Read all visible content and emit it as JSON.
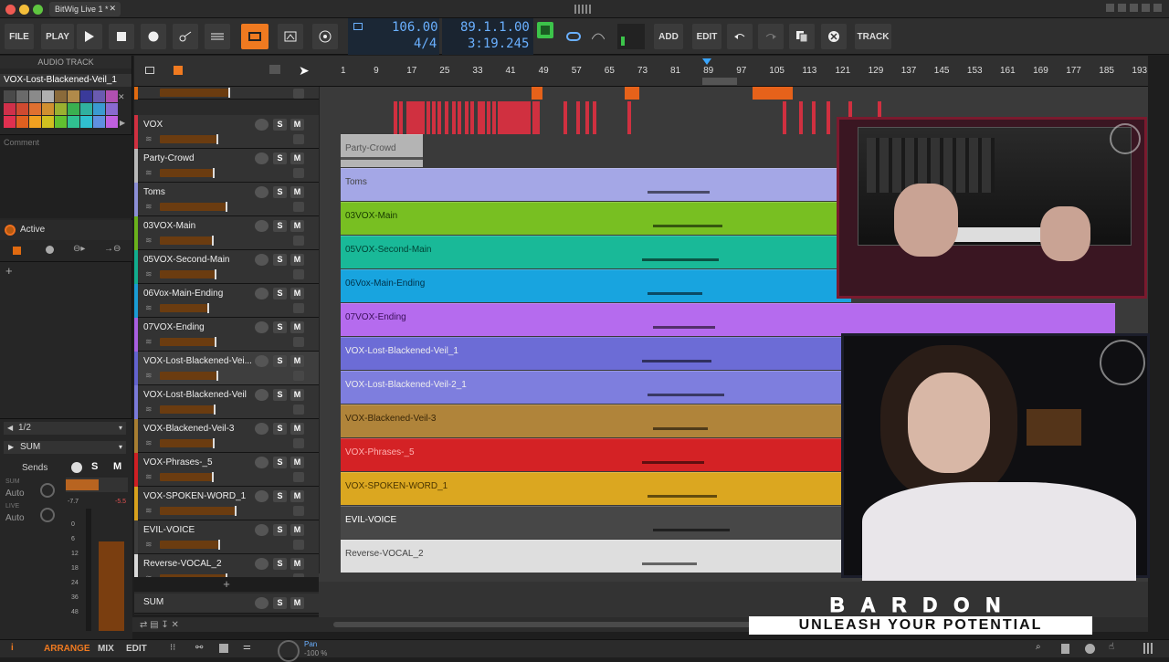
{
  "window": {
    "tab_title": "BitWig Live 1 *",
    "tab_close": "✕"
  },
  "toolbar": {
    "file": "FILE",
    "play_label": "PLAY",
    "add": "ADD",
    "edit": "EDIT",
    "track": "TRACK",
    "tempo": "106.00",
    "signature": "4/4",
    "position": "89.1.1.00",
    "time": "3:19.245"
  },
  "inspector": {
    "section": "AUDIO TRACK",
    "track_name": "VOX-Lost-Blackened-Veil_1",
    "comment_label": "Comment",
    "device_label": "Active",
    "add": "+",
    "palette": [
      "#4a4a4a",
      "#6a6a6a",
      "#8a8a8a",
      "#b0b0b0",
      "#8a6a3a",
      "#b08a4a",
      "#3a3a9a",
      "#6a5ab0",
      "#b050b0",
      "#d0304a",
      "#d04a30",
      "#e07030",
      "#d09030",
      "#9ab030",
      "#3ab050",
      "#30b0a0",
      "#3a9ad0",
      "#8a6ad0",
      "#e03050",
      "#e06020",
      "#f0a020",
      "#d0c020",
      "#60c030",
      "#30c090",
      "#30c0d0",
      "#6090e0",
      "#c060e0"
    ]
  },
  "sends": {
    "page": "1/2",
    "sum": "SUM",
    "sends_label": "Sends",
    "s": "S",
    "m": "M",
    "sum_small": "SUM",
    "auto1": "Auto",
    "live": "LIVE",
    "auto2": "Auto",
    "db_left": "-7.7",
    "db_right": "-5.5",
    "scale": [
      "0",
      "6",
      "12",
      "18",
      "24",
      "36",
      "48"
    ]
  },
  "tracks": [
    {
      "name": "",
      "color": "#e06a10",
      "fader": 0.75
    },
    {
      "name": "VOX",
      "color": "#d03040",
      "fader": 0.62
    },
    {
      "name": "Party-Crowd",
      "color": "#b9b9b9",
      "fader": 0.58
    },
    {
      "name": "Toms",
      "color": "#8c8fd6",
      "fader": 0.72
    },
    {
      "name": "03VOX-Main",
      "color": "#6ab21c",
      "fader": 0.57
    },
    {
      "name": "05VOX-Second-Main",
      "color": "#12ad8e",
      "fader": 0.6
    },
    {
      "name": "06Vox-Main-Ending",
      "color": "#1a9cd4",
      "fader": 0.52
    },
    {
      "name": "07VOX-Ending",
      "color": "#a85fe0",
      "fader": 0.6
    },
    {
      "name": "VOX-Lost-Blackened-Vei...",
      "color": "#6363cf",
      "fader": 0.62
    },
    {
      "name": "VOX-Lost-Blackened-Veil",
      "color": "#7a7ad9",
      "fader": 0.59
    },
    {
      "name": "VOX-Blackened-Veil-3",
      "color": "#a87e32",
      "fader": 0.58
    },
    {
      "name": "VOX-Phrases-_5",
      "color": "#cf1f23",
      "fader": 0.57
    },
    {
      "name": "VOX-SPOKEN-WORD_1",
      "color": "#d8a11d",
      "fader": 0.82
    },
    {
      "name": "EVIL-VOICE",
      "color": "#3d3d3d",
      "fader": 0.64
    },
    {
      "name": "Reverse-VOCAL_2",
      "color": "#d9d9d9",
      "fader": 0.72
    }
  ],
  "sum_track": {
    "name": "SUM"
  },
  "add_track": "+",
  "btn": {
    "s": "S",
    "m": "M"
  },
  "ruler": [
    "1",
    "9",
    "17",
    "25",
    "33",
    "41",
    "49",
    "57",
    "65",
    "73",
    "81",
    "89",
    "97",
    "105",
    "113",
    "121",
    "129",
    "137",
    "145",
    "153",
    "161",
    "169",
    "177",
    "185",
    "193"
  ],
  "clips": [
    {
      "label": "Party-Crowd",
      "color": "#b4b4b4",
      "text": "#555",
      "start": 1,
      "end": 21
    },
    {
      "label": "Toms",
      "color": "#a4a7e6",
      "text": "#444",
      "start": 1,
      "end": 125
    },
    {
      "label": "03VOX-Main",
      "color": "#78bf22",
      "text": "#173a00",
      "start": 1,
      "end": 125
    },
    {
      "label": "05VOX-Second-Main",
      "color": "#19b998",
      "text": "#004436",
      "start": 1,
      "end": 125
    },
    {
      "label": "06Vox-Main-Ending",
      "color": "#18a4df",
      "text": "#00324a",
      "start": 1,
      "end": 125
    },
    {
      "label": "07VOX-Ending",
      "color": "#b56bee",
      "text": "#3a1058",
      "start": 1,
      "end": 189
    },
    {
      "label": "VOX-Lost-Blackened-Veil_1",
      "color": "#6c6cd6",
      "text": "#eee",
      "start": 1,
      "end": 125
    },
    {
      "label": "VOX-Lost-Blackened-Veil-2_1",
      "color": "#7e7ede",
      "text": "#eee",
      "start": 1,
      "end": 125
    },
    {
      "label": "VOX-Blackened-Veil-3",
      "color": "#b0843a",
      "text": "#3a2708",
      "start": 1,
      "end": 125
    },
    {
      "label": "VOX-Phrases-_5",
      "color": "#d42225",
      "text": "#ffb0b0",
      "start": 1,
      "end": 125
    },
    {
      "label": "VOX-SPOKEN-WORD_1",
      "color": "#dba720",
      "text": "#4a3500",
      "start": 1,
      "end": 125
    },
    {
      "label": "EVIL-VOICE",
      "color": "#474747",
      "text": "#fff",
      "start": 1,
      "end": 125
    },
    {
      "label": "Reverse-VOCAL_2",
      "color": "#dedede",
      "text": "#444",
      "start": 1,
      "end": 125
    }
  ],
  "bottom": {
    "arrange": "ARRANGE",
    "mix": "MIX",
    "edit": "EDIT",
    "pan": "Pan",
    "pan_val": "-100 %"
  },
  "logo": {
    "line1": "BARDON",
    "line2": "UNLEASH YOUR POTENTIAL"
  }
}
